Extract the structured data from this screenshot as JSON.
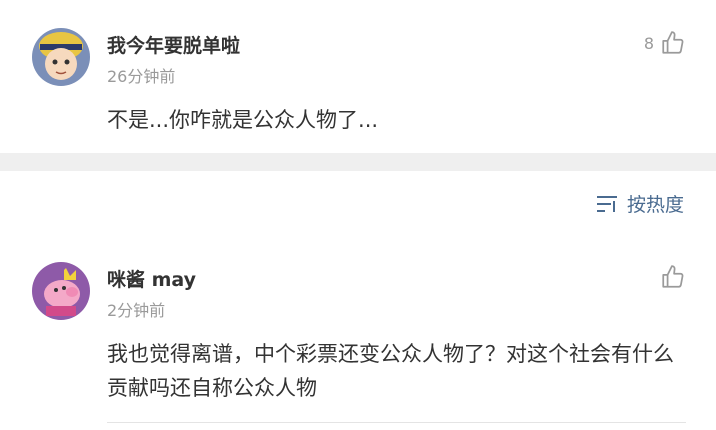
{
  "comments": [
    {
      "username": "我今年要脱单啦",
      "time": "26分钟前",
      "text": "不是...你咋就是公众人物了...",
      "likes": "8"
    },
    {
      "username": "咪酱 may",
      "time": "2分钟前",
      "text": "我也觉得离谱，中个彩票还变公众人物了？对这个社会有什么贡献吗还自称公众人物",
      "likes": ""
    }
  ],
  "sort": {
    "label": "按热度",
    "icon": "sort-icon"
  },
  "colors": {
    "accent": "#4a6b90",
    "divider": "#efefef",
    "muted": "#9a9a9a"
  }
}
